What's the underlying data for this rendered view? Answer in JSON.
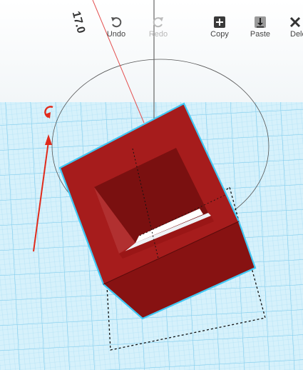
{
  "toolbar": {
    "undo_label": "Undo",
    "redo_label": "Redo",
    "copy_label": "Copy",
    "paste_label": "Paste",
    "delete_label": "Dele"
  },
  "rotation": {
    "angle_text": "17.0"
  },
  "colors": {
    "workplane_grid": "#8fd3f0",
    "workplane_bg": "#cdeefa",
    "shape_red": "#a01c1c",
    "selection_blue": "#42c8f4",
    "rotation_arrow": "#e02b1c"
  },
  "icons": [
    "undo-icon",
    "redo-icon",
    "copy-icon",
    "paste-icon",
    "rotate-handle-icon"
  ]
}
